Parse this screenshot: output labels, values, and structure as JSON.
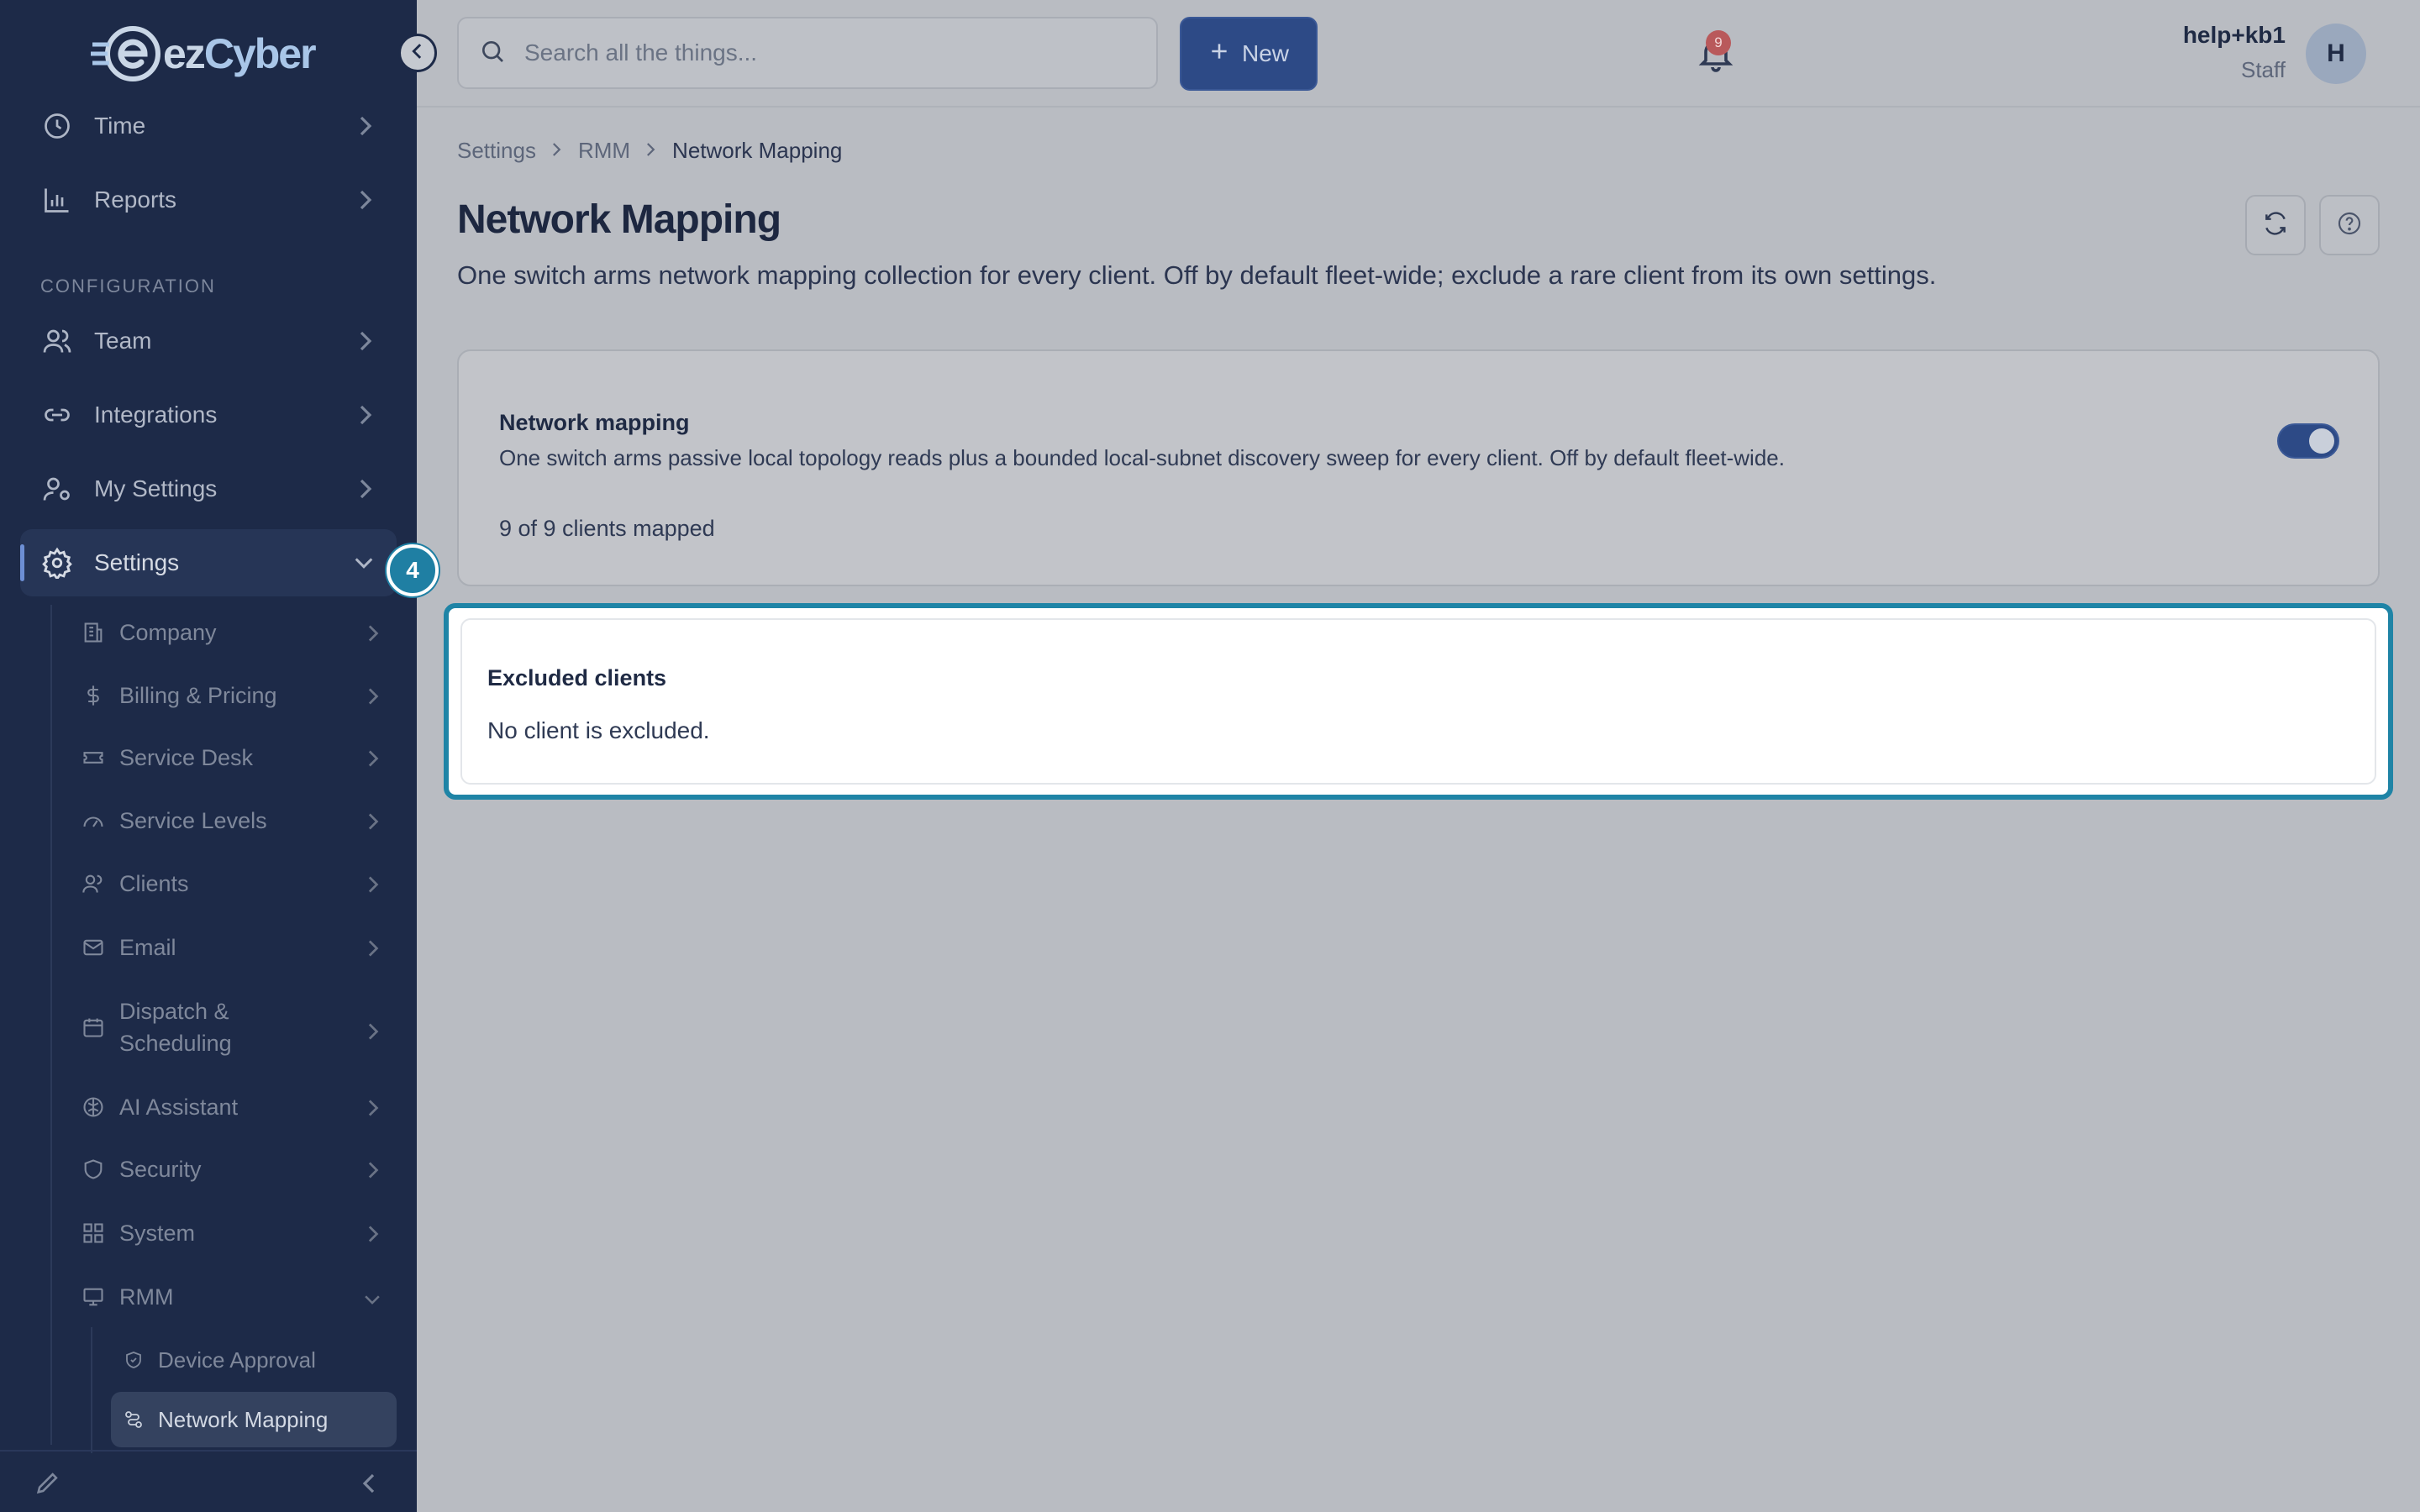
{
  "brand": {
    "name_prefix": "ez",
    "name_suffix": "Cyber"
  },
  "sidebar": {
    "top_items": [
      {
        "label": "Time",
        "icon": "clock-icon"
      },
      {
        "label": "Reports",
        "icon": "bar-chart-icon"
      }
    ],
    "section_label": "CONFIGURATION",
    "config_items": [
      {
        "label": "Team",
        "icon": "users-icon"
      },
      {
        "label": "Integrations",
        "icon": "link-icon"
      },
      {
        "label": "My Settings",
        "icon": "user-gear-icon"
      },
      {
        "label": "Settings",
        "icon": "gear-icon",
        "active": true
      }
    ],
    "settings_children": [
      {
        "label": "Company",
        "icon": "building-icon"
      },
      {
        "label": "Billing & Pricing",
        "icon": "dollar-icon"
      },
      {
        "label": "Service Desk",
        "icon": "ticket-icon"
      },
      {
        "label": "Service Levels",
        "icon": "gauge-icon"
      },
      {
        "label": "Clients",
        "icon": "users-icon"
      },
      {
        "label": "Email",
        "icon": "mail-icon"
      },
      {
        "label": "Dispatch & Scheduling",
        "icon": "calendar-icon"
      },
      {
        "label": "AI Assistant",
        "icon": "brain-icon"
      },
      {
        "label": "Security",
        "icon": "shield-icon"
      },
      {
        "label": "System",
        "icon": "grid-icon"
      },
      {
        "label": "RMM",
        "icon": "monitor-icon"
      }
    ],
    "rmm_children": [
      {
        "label": "Device Approval",
        "icon": "shield-check-icon"
      },
      {
        "label": "Network Mapping",
        "icon": "network-icon",
        "active": true
      }
    ],
    "step_badge": "4"
  },
  "topbar": {
    "search_placeholder": "Search all the things...",
    "new_label": "New",
    "notification_count": "9",
    "user_name": "help+kb1",
    "user_role": "Staff",
    "avatar_initial": "H"
  },
  "breadcrumb": [
    "Settings",
    "RMM",
    "Network Mapping"
  ],
  "page": {
    "title": "Network Mapping",
    "description": "One switch arms network mapping collection for every client. Off by default fleet-wide; exclude a rare client from its own settings."
  },
  "mapping_card": {
    "title": "Network mapping",
    "description": "One switch arms passive local topology reads plus a bounded local-subnet discovery sweep for every client. Off by default fleet-wide.",
    "status": "9 of 9 clients mapped",
    "enabled": true
  },
  "excluded_card": {
    "title": "Excluded clients",
    "empty_text": "No client is excluded."
  },
  "colors": {
    "sidebar_bg": "#1d2a48",
    "accent": "#2d4a86",
    "highlight": "#1f84a6",
    "badge": "#b9595b"
  }
}
